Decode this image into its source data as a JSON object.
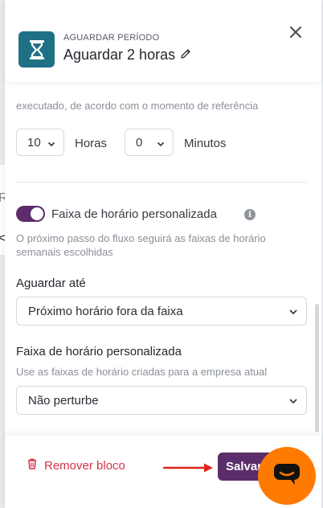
{
  "background": {
    "letter": "R",
    "chevron": "<"
  },
  "header": {
    "kicker": "AGUARDAR PERÍODO",
    "title": "Aguardar 2 horas",
    "icon": "hourglass-icon",
    "edit_icon": "pencil-icon",
    "close_icon": "close-icon",
    "accent": "#1f7085"
  },
  "content": {
    "cut_text": "executado, de acordo com o momento de referência",
    "hours_value": "10",
    "hours_label": "Horas",
    "minutes_value": "0",
    "minutes_label": "Minutos",
    "toggle_label": "Faixa de horário personalizada",
    "toggle_on": true,
    "toggle_color": "#5c2b6b",
    "help_text": "O próximo passo do fluxo seguirá as faixas de horário semanais escolhidas",
    "wait_until": {
      "label": "Aguardar até",
      "value": "Próximo horário fora da faixa"
    },
    "custom_range": {
      "label": "Faixa de horário personalizada",
      "hint": "Use as faixas de horário criadas para a empresa atual",
      "value": "Não perturbe"
    }
  },
  "footer": {
    "remove_label": "Remover bloco",
    "remove_color": "#d5334a",
    "save_label": "Salvar",
    "save_color": "#5b2d6a",
    "arrow_color": "#e0241b"
  },
  "chat_widget": {
    "icon": "chat-bubble-icon",
    "color": "#ff7a00"
  }
}
